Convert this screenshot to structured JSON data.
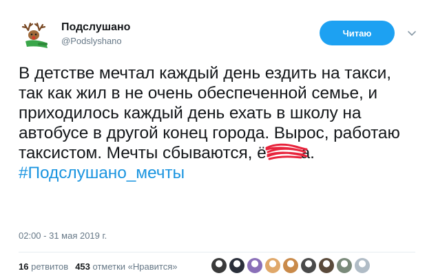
{
  "author": {
    "name": "Подслушано",
    "handle": "@Podslyshano",
    "avatar_icon": "reindeer-icon"
  },
  "follow_button": {
    "label": "Читаю",
    "color": "#1da1f2"
  },
  "menu": {
    "icon": "chevron-down-icon"
  },
  "tweet": {
    "text_before": "В детстве мечтал каждый день ездить на такси, так как жил в не очень обеспеченной семье, и приходилось каждый день ехать в школу на автобусе в другой конец города. Вырос, работаю таксистом. Мечты сбываются, ",
    "obscured_start": "ё",
    "obscured_end": "а",
    "text_after": ".",
    "hashtag": "#Подслушано_мечты",
    "hashtag_color": "#1b95e0",
    "scribble_color": "#e8243c"
  },
  "timestamp": "02:00 - 31 мая 2019 г.",
  "stats": {
    "retweets_count": "16",
    "retweets_label": "ретвитов",
    "likes_count": "453",
    "likes_label": "отметки «Нравится»"
  },
  "likers": [
    {
      "name": "liker-avatar-1",
      "color": "#3a3a3a"
    },
    {
      "name": "liker-avatar-2",
      "color": "#2a2f3a"
    },
    {
      "name": "liker-avatar-3",
      "color": "#8a6fb8"
    },
    {
      "name": "liker-avatar-4",
      "color": "#e0a86a"
    },
    {
      "name": "liker-avatar-5",
      "color": "#c98a4a"
    },
    {
      "name": "liker-avatar-6",
      "color": "#4a4a4a"
    },
    {
      "name": "liker-avatar-7",
      "color": "#5a4a3a"
    },
    {
      "name": "liker-avatar-8",
      "color": "#7a8a7a"
    },
    {
      "name": "liker-avatar-9",
      "color": "#b0bcc6"
    }
  ]
}
